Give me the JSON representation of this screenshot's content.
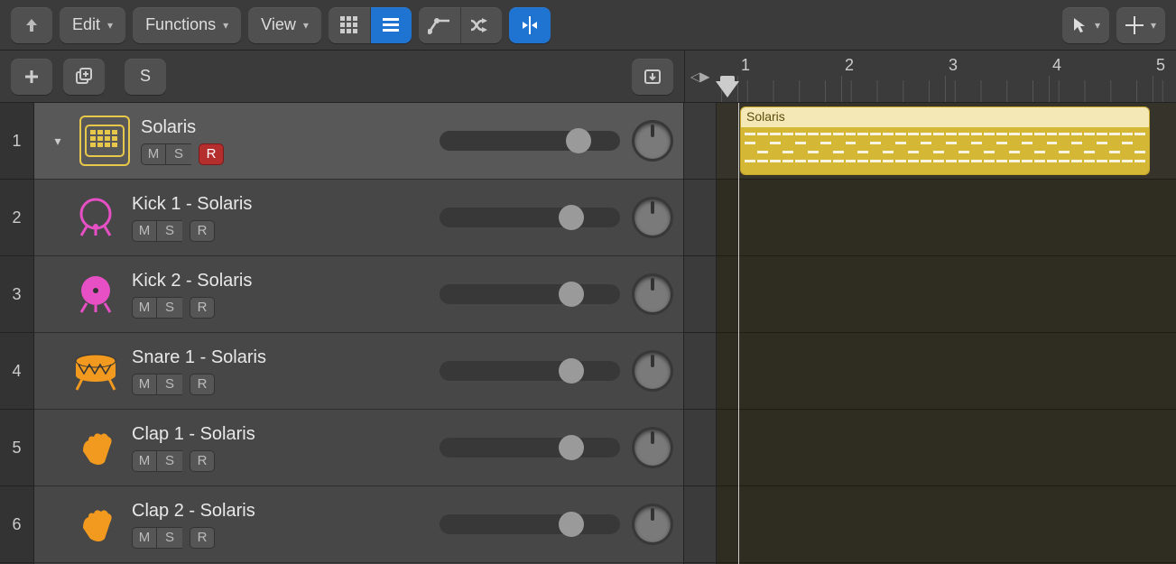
{
  "toolbar": {
    "edit": "Edit",
    "functions": "Functions",
    "view": "View"
  },
  "subbar": {
    "solo": "S"
  },
  "ruler": {
    "markers": [
      "1",
      "2",
      "3",
      "4",
      "5"
    ]
  },
  "tracks": [
    {
      "index": "1",
      "name": "Solaris",
      "m": "M",
      "s": "S",
      "r": "R",
      "rec": true,
      "parent": true,
      "icon": "drum-machine",
      "color": "#e8c84a",
      "vol": 0.7
    },
    {
      "index": "2",
      "name": "Kick 1 - Solaris",
      "m": "M",
      "s": "S",
      "r": "R",
      "rec": false,
      "parent": false,
      "icon": "kick",
      "color": "#e74fc4",
      "fill": false,
      "vol": 0.66
    },
    {
      "index": "3",
      "name": "Kick 2 - Solaris",
      "m": "M",
      "s": "S",
      "r": "R",
      "rec": false,
      "parent": false,
      "icon": "kick",
      "color": "#e74fc4",
      "fill": true,
      "vol": 0.66
    },
    {
      "index": "4",
      "name": "Snare 1 - Solaris",
      "m": "M",
      "s": "S",
      "r": "R",
      "rec": false,
      "parent": false,
      "icon": "snare",
      "color": "#f19a1f",
      "vol": 0.66
    },
    {
      "index": "5",
      "name": "Clap 1 - Solaris",
      "m": "M",
      "s": "S",
      "r": "R",
      "rec": false,
      "parent": false,
      "icon": "clap",
      "color": "#f19a1f",
      "vol": 0.66
    },
    {
      "index": "6",
      "name": "Clap 2 - Solaris",
      "m": "M",
      "s": "S",
      "r": "R",
      "rec": false,
      "parent": false,
      "icon": "clap",
      "color": "#f19a1f",
      "vol": 0.66
    }
  ],
  "region": {
    "name": "Solaris"
  }
}
